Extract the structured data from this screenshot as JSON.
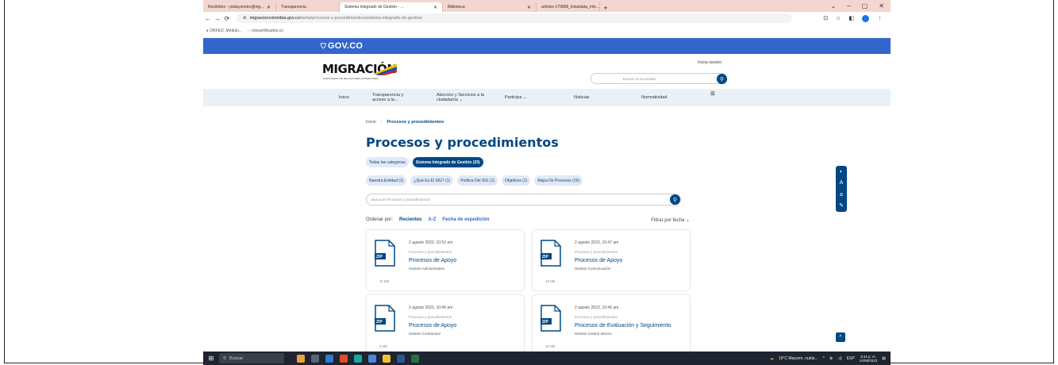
{
  "browser": {
    "tabs": [
      {
        "label": "Recibidos - yisttayoneiro@ing...",
        "active": false
      },
      {
        "label": "Transparencia",
        "active": false
      },
      {
        "label": "Sistema Integrado de Gestión - ...",
        "active": true
      },
      {
        "label": "Biblioteca",
        "active": false
      },
      {
        "label": "articles-179858_listasdata_info...",
        "active": false
      }
    ],
    "new_tab": "+",
    "url_host": "migracioncolombia.gov.co",
    "url_path": "/tema/procesos-y-procedimientos/sistema-integrado-de-gestion",
    "bookmarks": [
      "ORFEO, Módulo...",
      "miscertificados.co"
    ]
  },
  "gov": {
    "label": "GOV.CO"
  },
  "header": {
    "logo": "MIGRACIÓN",
    "logo_sub": "MINISTERIO DE RELACIONES EXTERIORES",
    "login": "Inicia sesión",
    "search_placeholder": "Buscar en la entidad"
  },
  "nav": {
    "items": [
      "Inicio",
      "Transparencia y acceso a la...",
      "Atención y Servicios a la ciudadanía ⌄",
      "Participa ⌄",
      "Noticias",
      "Normatividad"
    ]
  },
  "breadcrumb": {
    "home": "Inicio",
    "sep": "/",
    "current": "Procesos y procedimientos"
  },
  "page": {
    "title": "Procesos y procedimientos"
  },
  "filters": {
    "row1": [
      {
        "label": "Todas las categorías",
        "active": false
      },
      {
        "label": "Sistema Integrado de Gestión (20)",
        "active": true
      }
    ],
    "row2": [
      {
        "label": "Nuestra Entidad (1)"
      },
      {
        "label": "¿Qué Es El SIG? (1)"
      },
      {
        "label": "Política Del SIG (1)"
      },
      {
        "label": "Objetivos (1)"
      },
      {
        "label": "Mapa De Procesos (16)"
      }
    ],
    "search_placeholder": "Busca en Procesos y procedimientos"
  },
  "sort": {
    "label": "Ordenar por:",
    "selected": "Recientes",
    "options": [
      "A-Z",
      "Fecha de expedición"
    ],
    "date_filter": "Filtrar por fecha ⌄"
  },
  "cards": [
    {
      "date": "2 agosto 2023, 10:52 am",
      "category": "Procesos y procedimientos",
      "title": "Procesos de Apoyo",
      "subtitle": "Gestión Administrativa",
      "size": "11 Mb",
      "badge": "ZIP"
    },
    {
      "date": "2 agosto 2023, 10:47 am",
      "category": "Procesos y procedimientos",
      "title": "Procesos de Apoyo",
      "subtitle": "Gestión Comunicación",
      "size": "10 Mb",
      "badge": "ZIP"
    },
    {
      "date": "2 agosto 2023, 10:46 am",
      "category": "Procesos y procedimientos",
      "title": "Procesos de Apoyo",
      "subtitle": "Gestión Contractual",
      "size": "9 Mb",
      "badge": "ZIP"
    },
    {
      "date": "2 agosto 2023, 10:46 am",
      "category": "Procesos y procedimientos",
      "title": "Procesos de Evaluación y Seguimiento",
      "subtitle": "Gestión Control Interno",
      "size": "10 Mb",
      "badge": "ZIP"
    }
  ],
  "taskbar": {
    "search": "Buscar",
    "weather": "19°C Mayorm. nubla...",
    "lang": "ESP",
    "time": "3:34 p. m.",
    "date": "10/08/2023"
  },
  "colors": {
    "brand": "#004884",
    "gov": "#3366cc",
    "chip": "#e1e9f5"
  }
}
